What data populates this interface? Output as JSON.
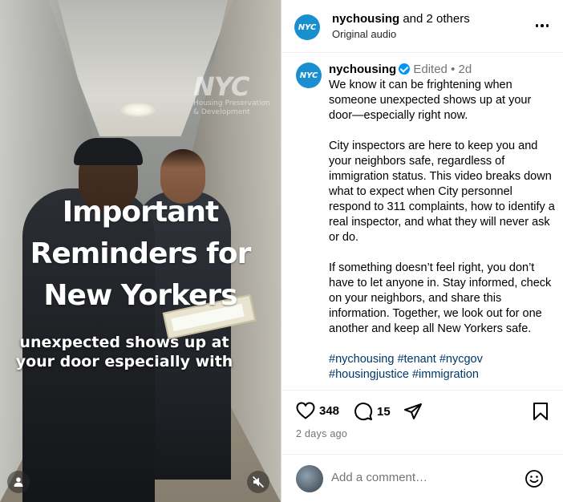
{
  "video": {
    "logo_big": "NYC",
    "logo_sub_line1": "Housing Preservation",
    "logo_sub_line2": "& Development",
    "title_lines": [
      "Important",
      "Reminders for",
      "New Yorkers"
    ],
    "caption_lines": [
      "unexpected shows up at",
      "your door especially with"
    ],
    "user_icon": "person-icon",
    "mute_icon": "muted-speaker-icon"
  },
  "header": {
    "avatar_text": "NYC",
    "username": "nychousing",
    "others": "and 2 others",
    "audio": "Original audio",
    "more_icon": "more-horizontal-icon"
  },
  "post": {
    "avatar_text": "NYC",
    "username": "nychousing",
    "edited": "Edited",
    "dot": "•",
    "age": "2d",
    "paragraphs": [
      "We know it can be frightening when someone unexpected shows up at your door—especially right now.",
      "City inspectors are here to keep you and your neighbors safe, regardless of immigration status. This video breaks down what to expect when City personnel respond to 311 complaints, how to identify a real inspector, and what they will never ask or do.",
      "If something doesn’t feel right, you don’t have to let anyone in. Stay informed, check on your neighbors, and share this information. Together, we look out for one another and keep all New Yorkers safe."
    ],
    "hashtags": "#nychousing #tenant #nycgov #housingjustice #immigration"
  },
  "actions": {
    "like_count": "348",
    "comment_count": "15",
    "date": "2 days ago"
  },
  "comment": {
    "placeholder": "Add a comment…"
  }
}
